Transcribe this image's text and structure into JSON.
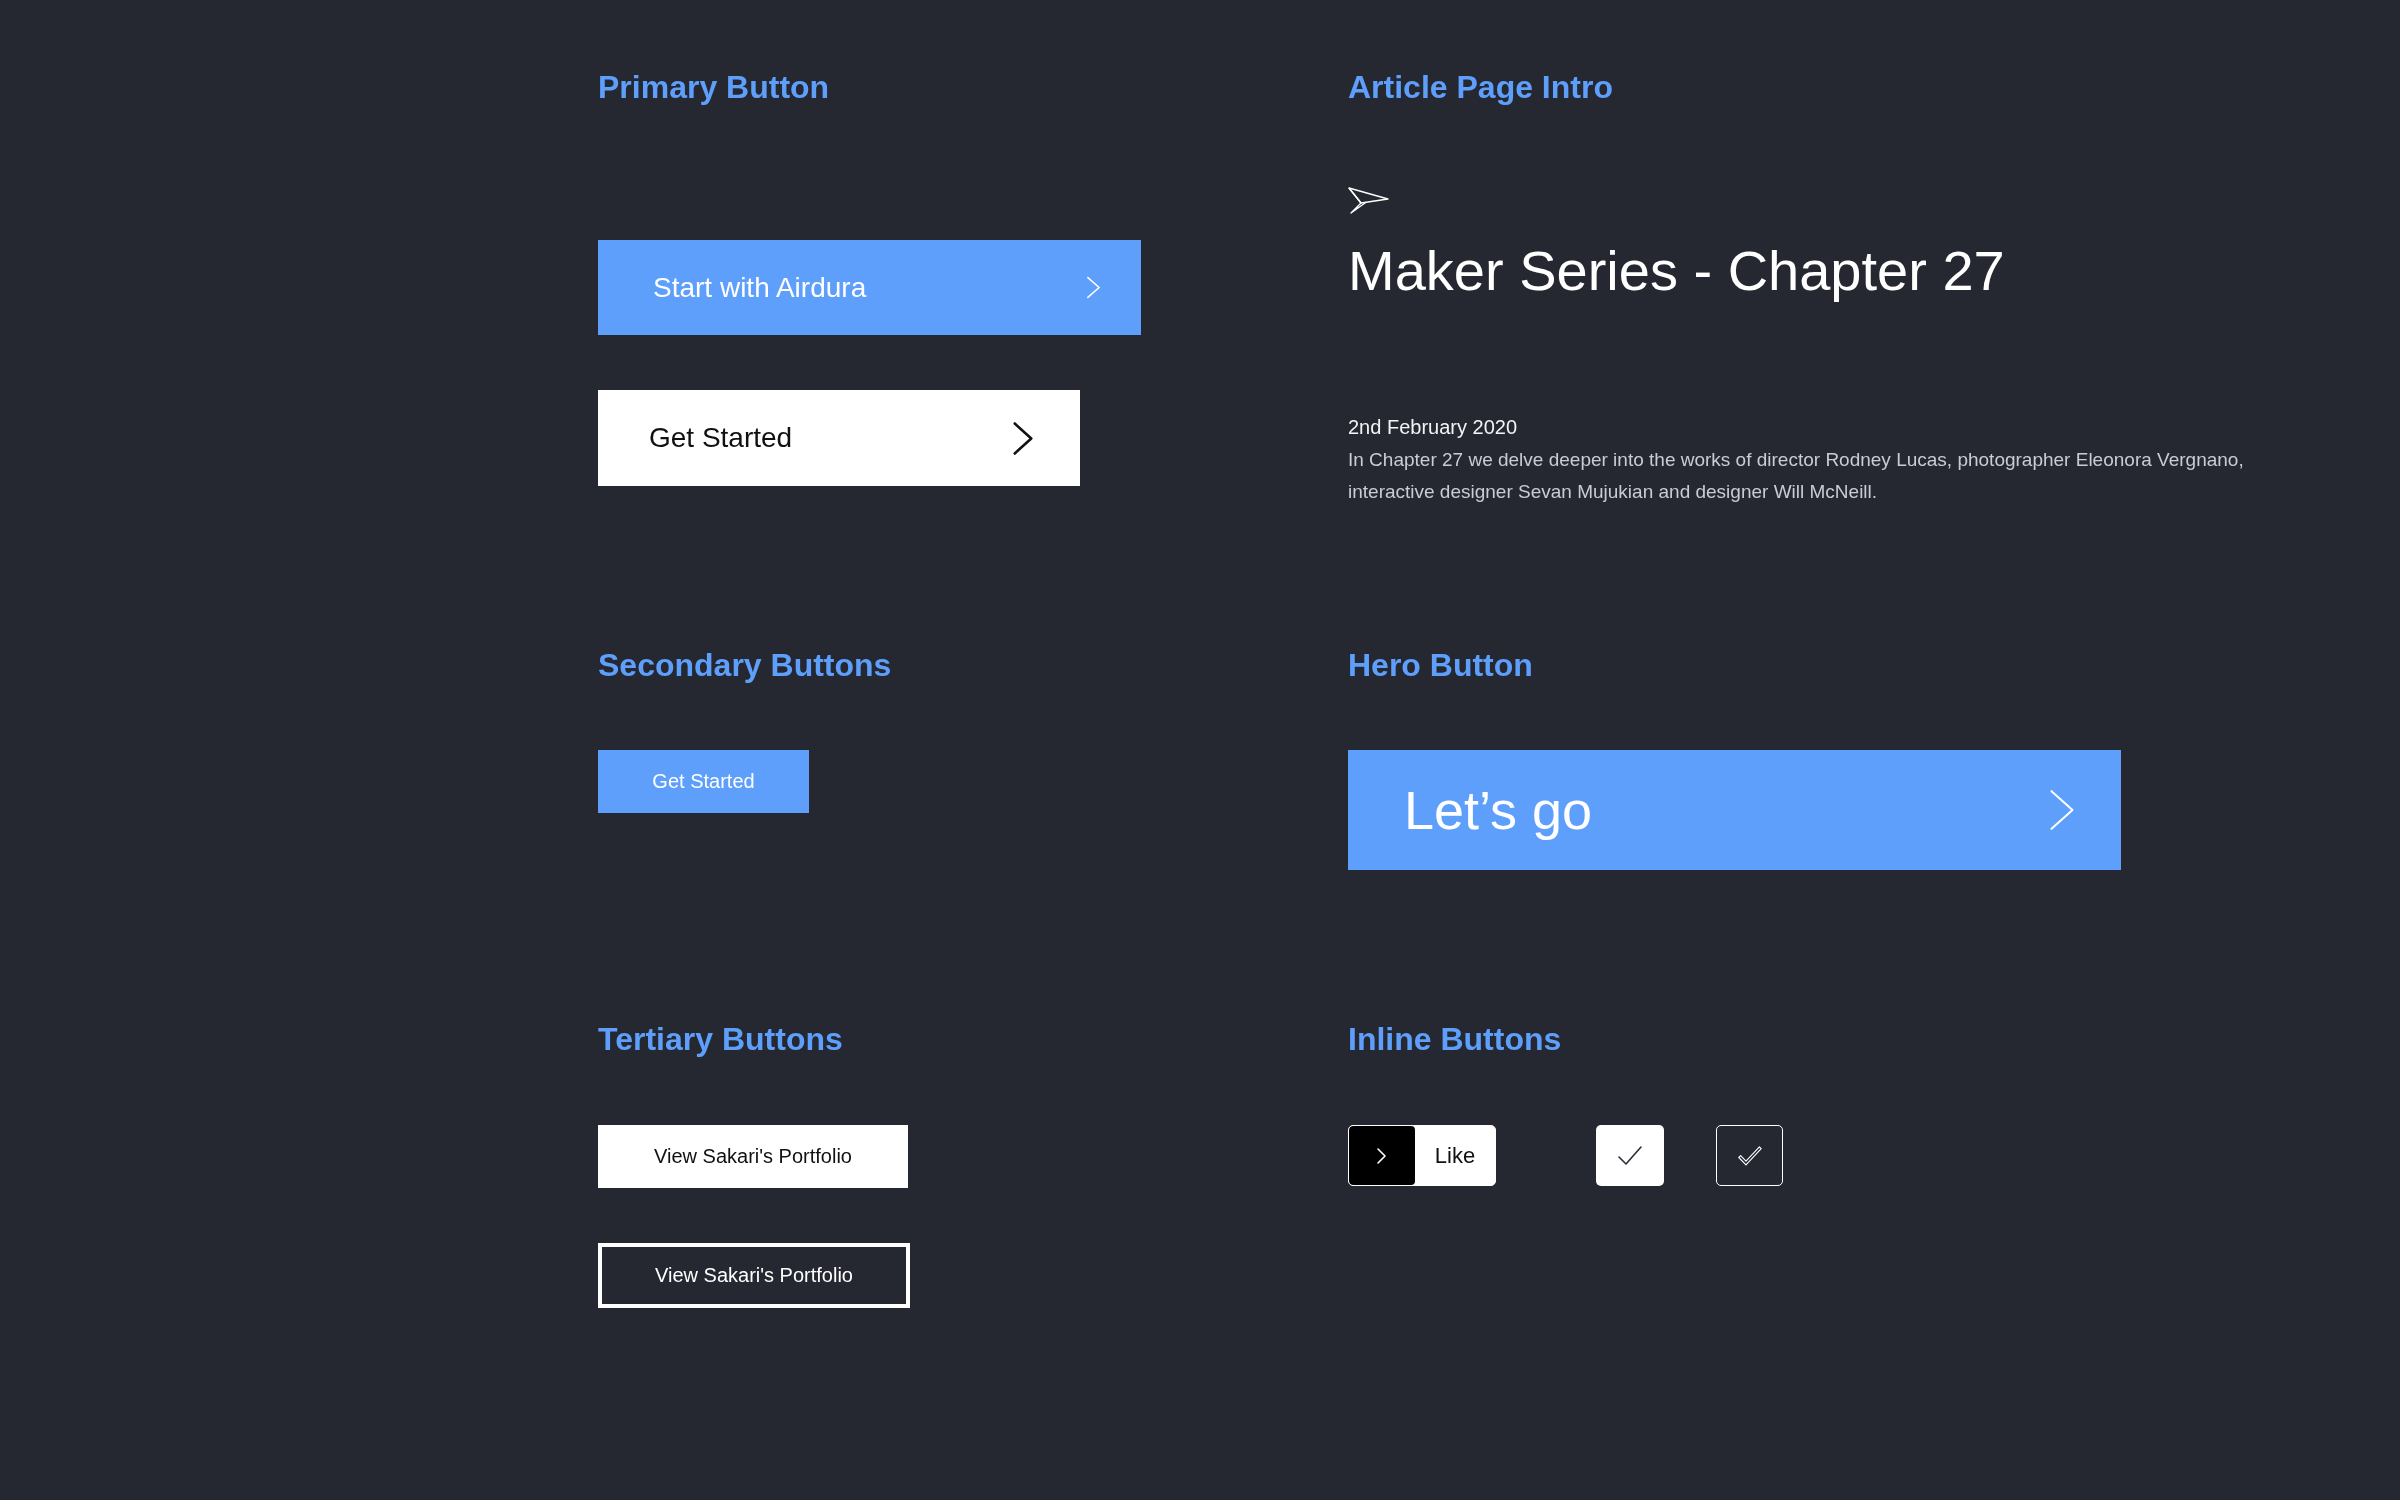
{
  "primary_button": {
    "heading": "Primary Button",
    "buttons": [
      {
        "label": "Start with Airdura",
        "kind": "primary"
      },
      {
        "label": "Get Started",
        "kind": "inverse"
      }
    ]
  },
  "article_page_intro": {
    "heading": "Article Page Intro",
    "title": "Maker Series - Chapter 27",
    "date": "2nd February 2020",
    "summary": "In Chapter 27 we delve deeper into the works of director Rodney Lucas, photographer Eleonora Vergnano, interactive designer Sevan Mujukian and designer Will McNeill."
  },
  "secondary_buttons": {
    "heading": "Secondary Buttons",
    "buttons": [
      {
        "label": "Get Started"
      }
    ]
  },
  "hero_button": {
    "heading": "Hero Button",
    "button": {
      "label": "Let’s go"
    }
  },
  "tertiary_buttons": {
    "heading": "Tertiary Buttons",
    "buttons": [
      {
        "label": "View Sakari's Portfolio",
        "kind": "filled"
      },
      {
        "label": "View Sakari's Portfolio",
        "kind": "outline"
      }
    ]
  },
  "inline_buttons": {
    "heading": "Inline Buttons",
    "buttons": [
      {
        "kind": "like",
        "label": "Like"
      },
      {
        "kind": "filled"
      },
      {
        "kind": "outline"
      }
    ]
  }
}
